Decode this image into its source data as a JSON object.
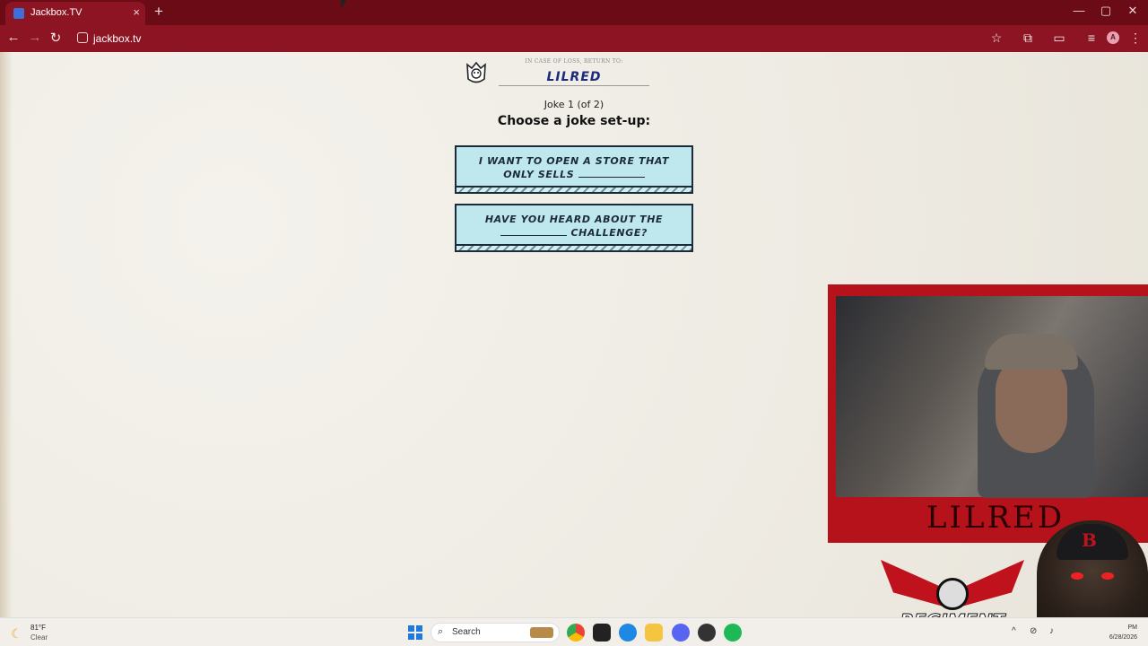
{
  "browser": {
    "tab_title": "Jackbox.TV",
    "tab_close": "×",
    "new_tab": "+",
    "url": "jackbox.tv",
    "window_controls": {
      "minimize": "—",
      "maximize": "▢",
      "close": "✕"
    },
    "profile_initial": "A"
  },
  "game": {
    "return_label": "IN CASE OF LOSS, RETURN TO:",
    "player_name": "LILRED",
    "joke_count": "Joke 1 (of 2)",
    "prompt_title": "Choose a joke set-up:",
    "setups": [
      {
        "line1": "I want to open a store that",
        "line2_prefix": "only sells"
      },
      {
        "line1": "Have you heard about the",
        "line2_suffix": "challenge?"
      }
    ]
  },
  "stream_overlay": {
    "camera_name": "LILRED",
    "logo_text": "REGIMENT",
    "skull_letter": "B"
  },
  "taskbar": {
    "weather_temp": "81°F",
    "weather_condition": "Clear",
    "search_label": "Search",
    "clock_time": "PM",
    "clock_date": "6/28/2026"
  },
  "icons": {
    "weather": "moon-icon",
    "search": "search-icon",
    "back": "back-arrow-icon",
    "forward": "forward-arrow-icon",
    "reload": "reload-icon",
    "star": "star-icon"
  },
  "colors": {
    "tab_bar": "#6a0b16",
    "address_bar": "#8d1422",
    "setup_button": "#bfe8ee",
    "player_name": "#1b2a7a",
    "overlay_red": "#b5121b"
  }
}
